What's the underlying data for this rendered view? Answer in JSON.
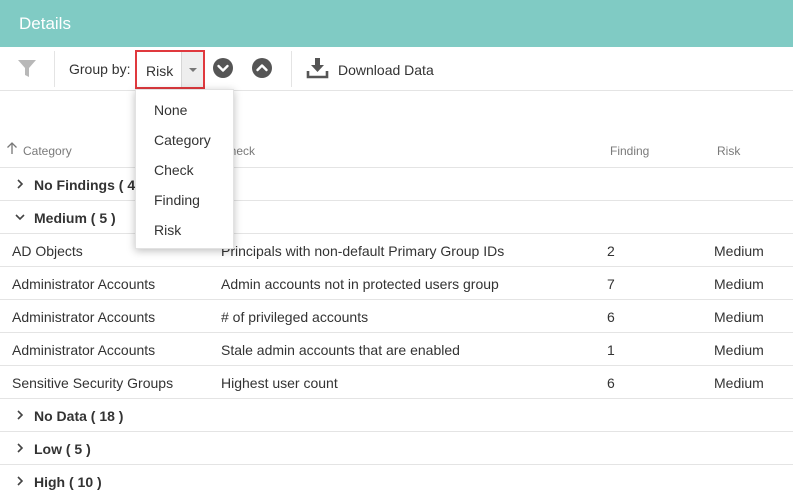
{
  "header": {
    "title": "Details"
  },
  "toolbar": {
    "group_by_label": "Group by:",
    "group_by_value": "Risk",
    "download_label": "Download Data"
  },
  "dropdown": {
    "options": [
      "None",
      "Category",
      "Check",
      "Finding",
      "Risk"
    ]
  },
  "table": {
    "columns": [
      "Category",
      "Check",
      "Finding",
      "Risk"
    ],
    "sort_column": "Category",
    "groups": {
      "no_findings": {
        "label": "No Findings ( 4",
        "expanded": false
      },
      "medium": {
        "label": "Medium ( 5 )",
        "expanded": true
      },
      "no_data": {
        "label": "No Data ( 18 )",
        "expanded": false
      },
      "low": {
        "label": "Low ( 5 )",
        "expanded": false
      },
      "high": {
        "label": "High ( 10 )",
        "expanded": false
      }
    },
    "rows": [
      {
        "category": "AD Objects",
        "check": "Principals with non-default Primary Group IDs",
        "finding": "2",
        "risk": "Medium"
      },
      {
        "category": "Administrator Accounts",
        "check": "Admin accounts not in protected users group",
        "finding": "7",
        "risk": "Medium"
      },
      {
        "category": "Administrator Accounts",
        "check": "# of privileged accounts",
        "finding": "6",
        "risk": "Medium"
      },
      {
        "category": "Administrator Accounts",
        "check": "Stale admin accounts that are enabled",
        "finding": "1",
        "risk": "Medium"
      },
      {
        "category": "Sensitive Security Groups",
        "check": "Highest user count",
        "finding": "6",
        "risk": "Medium"
      }
    ]
  },
  "colors": {
    "header_bg": "#80cbc4",
    "highlight_border": "#e0393e",
    "icon_dark": "#555555"
  },
  "icons": {
    "filter": "filter-icon",
    "expand_all": "chevron-down-circle-icon",
    "collapse_all": "chevron-up-circle-icon",
    "download": "download-icon",
    "sort": "arrow-up-icon"
  }
}
